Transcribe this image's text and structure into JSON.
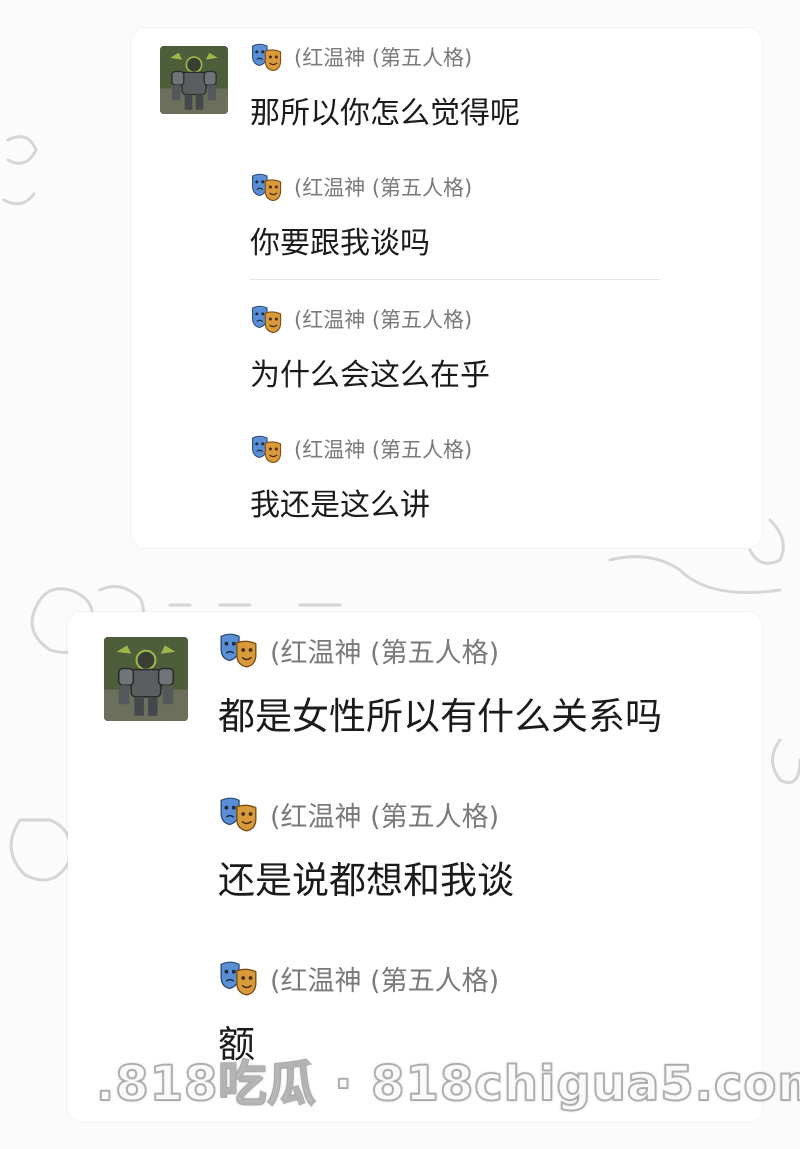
{
  "card1": {
    "messages": [
      {
        "sender": "(红温神 (第五人格)",
        "text": "那所以你怎么觉得呢"
      },
      {
        "sender": "(红温神 (第五人格)",
        "text": "你要跟我谈吗"
      },
      {
        "sender": "(红温神 (第五人格)",
        "text": "为什么会这么在乎"
      },
      {
        "sender": "(红温神 (第五人格)",
        "text": "我还是这么讲"
      }
    ]
  },
  "card2": {
    "messages": [
      {
        "sender": "(红温神 (第五人格)",
        "text": "都是女性所以有什么关系吗"
      },
      {
        "sender": "(红温神 (第五人格)",
        "text": "还是说都想和我谈"
      },
      {
        "sender": "(红温神 (第五人格)",
        "text": "额"
      }
    ]
  },
  "watermark": ".818吃瓜 · 818chigua5.com",
  "icons": {
    "avatar": "armored-character-avatar",
    "sender_badge": "drama-masks-icon"
  },
  "colors": {
    "background": "#fbfbfb",
    "card": "#ffffff",
    "sender_text": "#7a7a7a",
    "message_text": "#1b1b1b",
    "mask_blue": "#5a8fd6",
    "mask_gold": "#d99a3c"
  }
}
